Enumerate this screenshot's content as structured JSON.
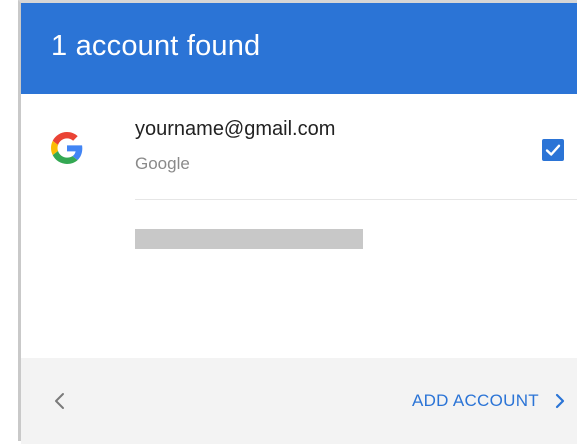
{
  "header": {
    "title": "1 account found"
  },
  "account": {
    "email": "yourname@gmail.com",
    "provider": "Google",
    "selected": true,
    "icon": "google-g-icon"
  },
  "footer": {
    "back_icon": "chevron-left-icon",
    "add_account_label": "ADD ACCOUNT",
    "add_account_icon": "chevron-right-icon"
  },
  "colors": {
    "accent": "#2b74d6",
    "footer_bg": "#f3f3f3",
    "placeholder": "#c8c8c8"
  }
}
